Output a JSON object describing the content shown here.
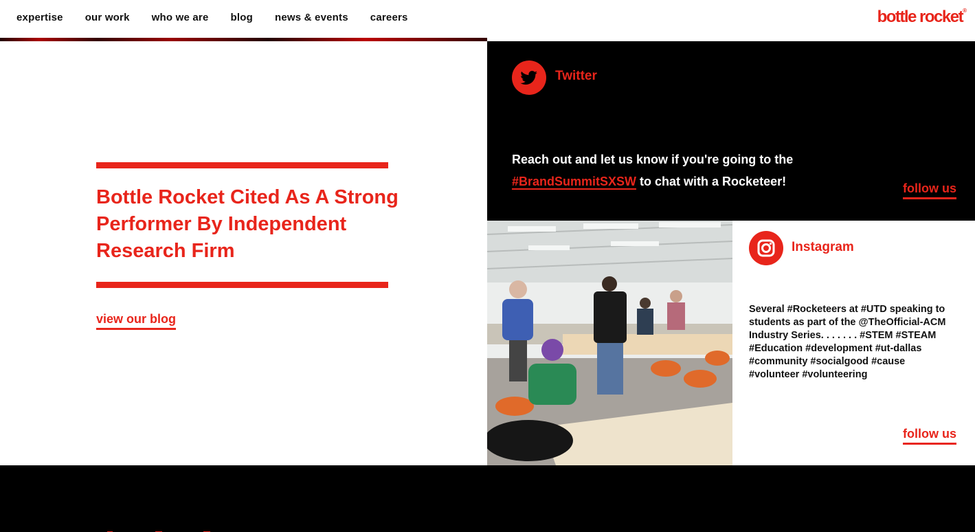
{
  "nav": {
    "items": [
      "expertise",
      "our work",
      "who we are",
      "blog",
      "news & events",
      "careers"
    ],
    "logo": "bottle rocket",
    "logo_mark": "®"
  },
  "blog": {
    "headline": "Bottle Rocket Cited As A Strong Performer By Independent Research Firm",
    "link": "view our blog"
  },
  "twitter": {
    "title": "Twitter",
    "text_before": "Reach out and let us know if you're going to the",
    "hashtag": "#BrandSummitSXSW",
    "text_after": "to chat with a Rocketeer!",
    "follow": "follow us",
    "icon": "twitter-bird-icon"
  },
  "instagram": {
    "title": "Instagram",
    "caption": "Several #Rocketeers at #UTD speaking to students as part of the @TheOfficial-ACM Industry Series. . . . . . . #STEM #STEAM #Education #development #ut-dallas #community #socialgood #cause #volunteer #volunteering",
    "follow": "follow us",
    "icon": "instagram-camera-icon"
  },
  "colors": {
    "accent": "#e8251b",
    "dark": "#000000"
  }
}
